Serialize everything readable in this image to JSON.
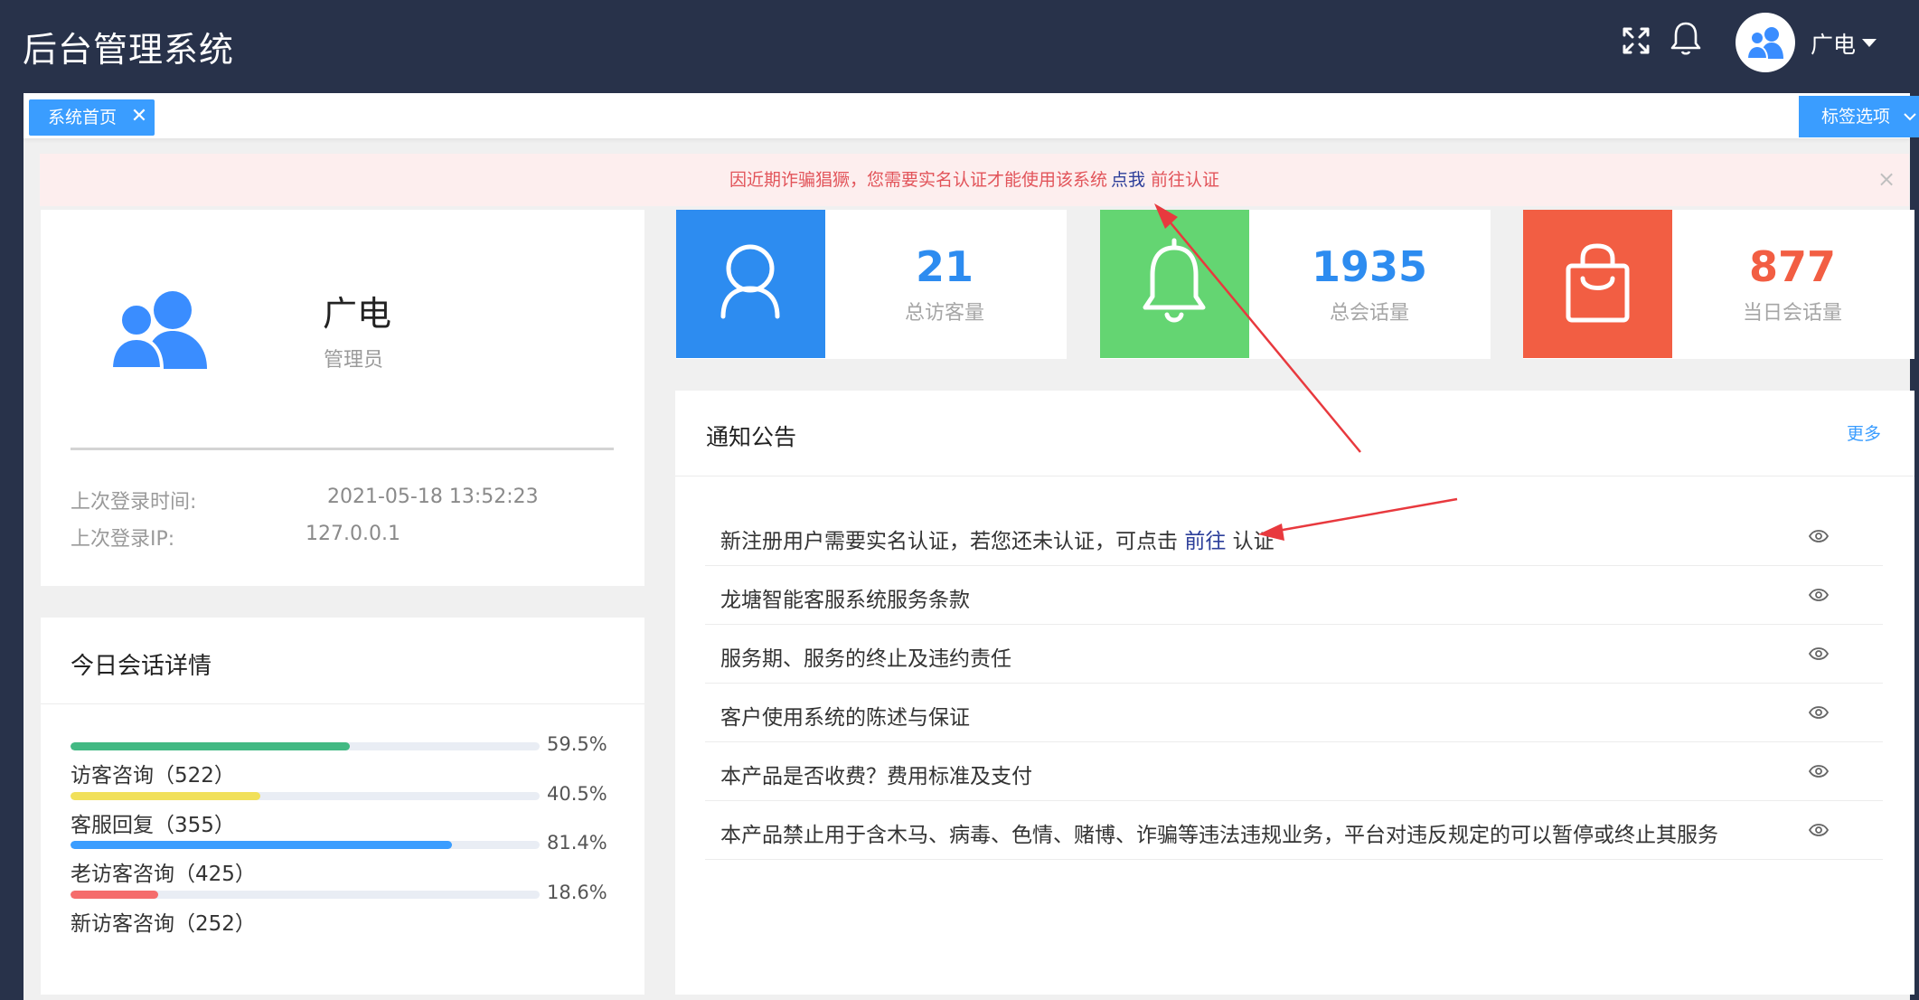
{
  "header": {
    "title": "后台管理系统",
    "user_name": "广电",
    "icons": [
      "fullscreen-icon",
      "bell-icon",
      "avatar-icon",
      "caret-down-icon"
    ]
  },
  "tabs": {
    "active_label": "系统首页",
    "options_label": "标签选项"
  },
  "alert": {
    "text": "因近期诈骗猖獗，您需要实名认证才能使用该系统",
    "link": "点我",
    "go": "前往认证"
  },
  "profile": {
    "name": "广电",
    "role": "管理员",
    "last_login_label": "上次登录时间:",
    "last_login_value": "2021-05-18 13:52:23",
    "last_ip_label": "上次登录IP:",
    "last_ip_value": "127.0.0.1"
  },
  "stats": [
    {
      "value": "21",
      "label": "总访客量",
      "color": "#2d8cf0",
      "icon": "user-icon"
    },
    {
      "value": "1935",
      "label": "总会话量",
      "color": "#64d572",
      "icon": "bell-icon"
    },
    {
      "value": "877",
      "label": "当日会话量",
      "color": "#f25e43",
      "icon": "bag-icon"
    }
  ],
  "stat_value_colors": [
    "#2d8cf0",
    "#2d8cf0",
    "#f25e43"
  ],
  "notices": {
    "title": "通知公告",
    "more": "更多",
    "items": [
      {
        "text": "新注册用户需要实名认证，若您还未认证，可点击",
        "link": "前往",
        "suffix": "认证"
      },
      {
        "text": "龙塘智能客服系统服务条款"
      },
      {
        "text": "服务期、服务的终止及违约责任"
      },
      {
        "text": "客户使用系统的陈述与保证"
      },
      {
        "text": "本产品是否收费？费用标准及支付"
      },
      {
        "text": "本产品禁止用于含木马、病毒、色情、赌博、诈骗等违法违规业务，平台对违反规定的可以暂停或终止其服务"
      }
    ]
  },
  "session": {
    "title": "今日会话详情",
    "bars": [
      {
        "label": "访客咨询（522）",
        "percent": "59.5%",
        "value": 59.5,
        "color": "#42b983"
      },
      {
        "label": "客服回复（355）",
        "percent": "40.5%",
        "value": 40.5,
        "color": "#f1e05a"
      },
      {
        "label": "老访客咨询（425）",
        "percent": "81.4%",
        "value": 81.4,
        "color": "#3a9dff"
      },
      {
        "label": "新访客咨询（252）",
        "percent": "18.6%",
        "value": 18.6,
        "color": "#f56c6c"
      }
    ]
  },
  "colors": {
    "header_bg": "#28324a",
    "accent": "#3a9dff",
    "alert_text": "#e2545a",
    "annotation_arrow": "#e8393e"
  }
}
